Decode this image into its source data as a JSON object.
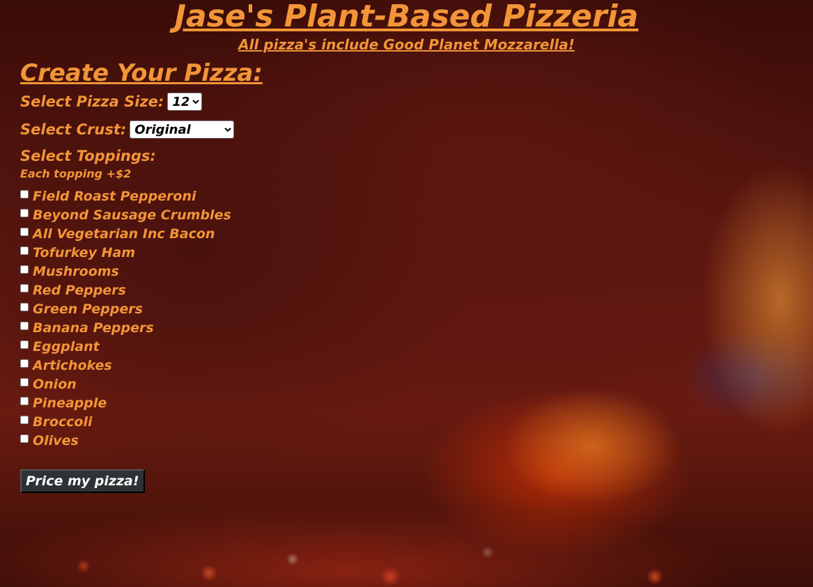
{
  "header": {
    "title": "Jase's Plant-Based Pizzeria",
    "subtitle": "All pizza's include Good Planet Mozzarella!"
  },
  "form": {
    "heading": "Create Your Pizza:",
    "size_label": "Select Pizza Size:",
    "size_value": "12\"",
    "crust_label": "Select Crust:",
    "crust_value": "Original",
    "toppings_label": "Select Toppings:",
    "toppings_note": "Each topping +$2",
    "toppings": [
      "Field Roast Pepperoni",
      "Beyond Sausage Crumbles",
      "All Vegetarian Inc Bacon",
      "Tofurkey Ham",
      "Mushrooms",
      "Red Peppers",
      "Green Peppers",
      "Banana Peppers",
      "Eggplant",
      "Artichokes",
      "Onion",
      "Pineapple",
      "Broccoli",
      "Olives"
    ],
    "submit_label": "Price my pizza!"
  },
  "colors": {
    "text_accent": "#f29538",
    "button_bg": "#2e3234",
    "background": "#5a160f"
  }
}
